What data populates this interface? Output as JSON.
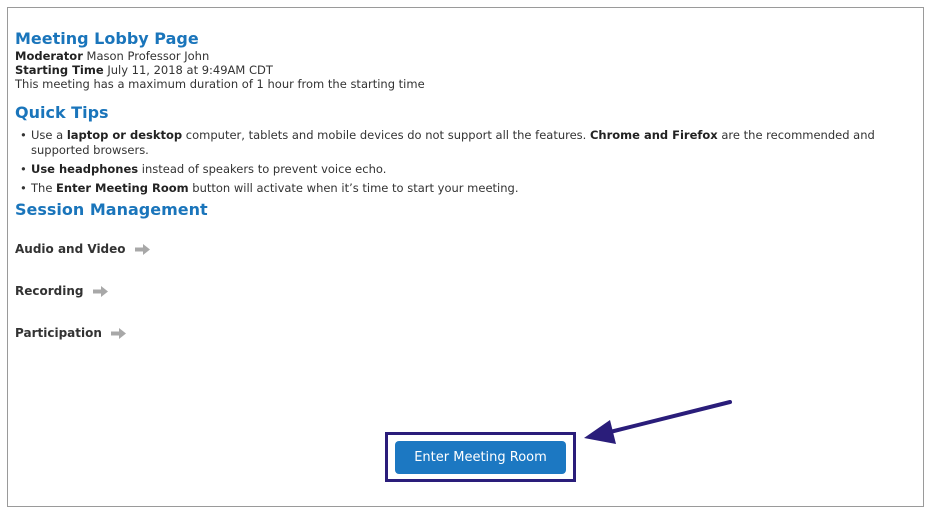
{
  "lobby": {
    "title": "Meeting Lobby Page",
    "moderator_label": "Moderator",
    "moderator_value": "Mason Professor John",
    "starting_label": "Starting Time",
    "starting_value": "July 11, 2018 at 9:49AM CDT",
    "duration_note": "This meeting has a maximum duration of 1 hour from the starting time"
  },
  "tips": {
    "title": "Quick Tips",
    "items": [
      {
        "p1": "Use a ",
        "b1": "laptop or desktop",
        "p2": " computer, tablets and mobile devices do not support all the features. ",
        "b2": "Chrome and Firefox",
        "p3": " are the recommended and supported browsers."
      },
      {
        "b1": "Use headphones",
        "p2": " instead of speakers to prevent voice echo."
      },
      {
        "p1": "The ",
        "b1": "Enter Meeting Room",
        "p2": " button will activate when it’s time to start your meeting."
      }
    ]
  },
  "session": {
    "title": "Session Management",
    "items": [
      {
        "label": "Audio and Video",
        "icon": "arrow-right-icon"
      },
      {
        "label": "Recording",
        "icon": "arrow-right-icon"
      },
      {
        "label": "Participation",
        "icon": "arrow-right-icon"
      }
    ]
  },
  "enter_button": {
    "label": "Enter Meeting Room"
  },
  "colors": {
    "heading": "#1a75bb",
    "button": "#1c78c2",
    "highlight": "#2a1d7a",
    "icon": "#a8a8a8"
  }
}
